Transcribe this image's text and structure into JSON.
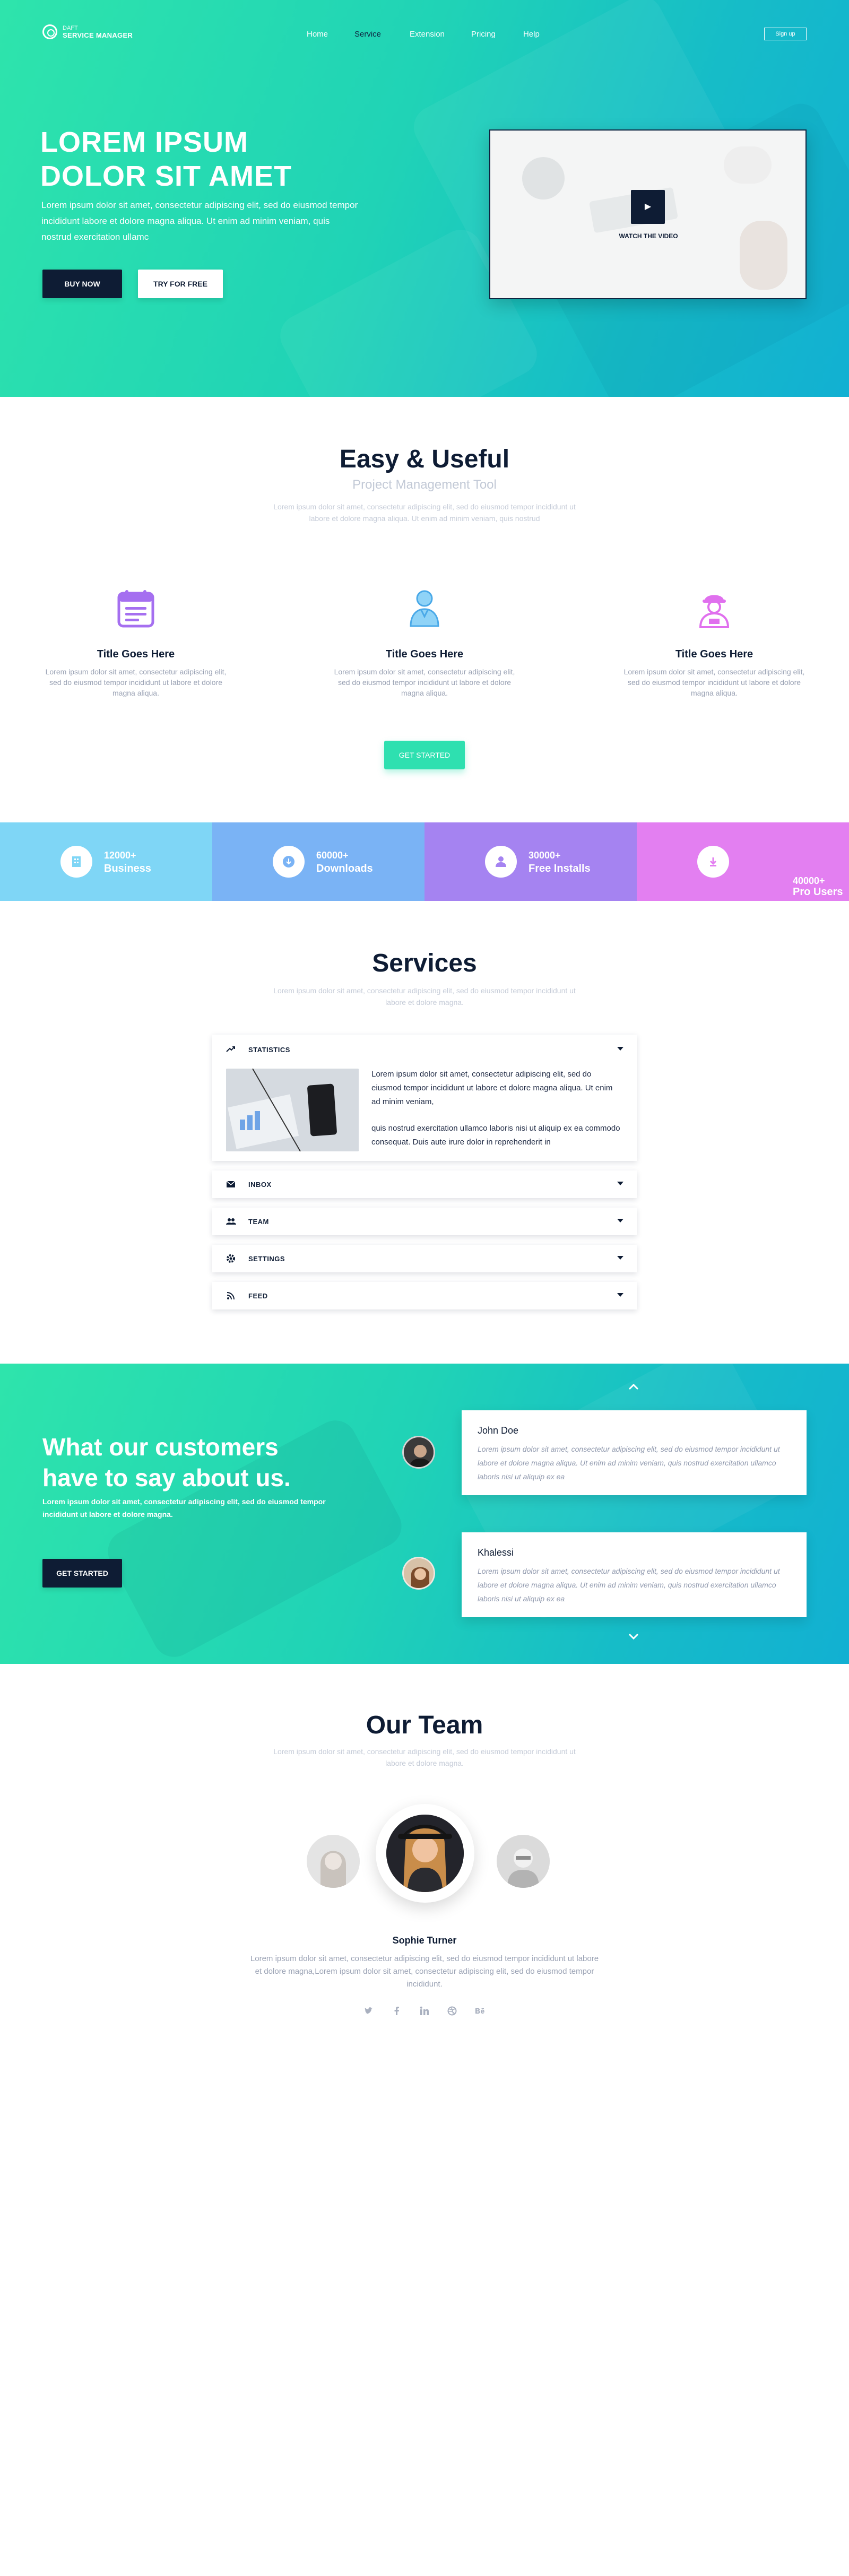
{
  "colors": {
    "primary_teal": "#2ee0b0",
    "dark_navy": "#0e1c34",
    "stat_1": "#7fd6f6",
    "stat_2": "#7ab3f5",
    "stat_3": "#a583f1",
    "stat_4": "#e37ff1"
  },
  "nav": {
    "logo_top": "DAFT",
    "logo_bottom": "SERVICE MANAGER",
    "items": [
      "Home",
      "Service",
      "Extension",
      "Pricing",
      "Help"
    ],
    "active": "Service",
    "signup": "Sign up"
  },
  "hero": {
    "title": "LOREM IPSUM DOLOR SIT AMET",
    "text": "Lorem ipsum dolor sit amet, consectetur adipiscing elit, sed do eiusmod tempor incididunt labore et dolore magna aliqua. Ut enim ad minim veniam, quis nostrud exercitation ullamc",
    "buy_now": "BUY NOW",
    "try_free": "TRY FOR FREE",
    "watch": "WATCH THE VIDEO"
  },
  "easy": {
    "title": "Easy & Useful",
    "subtitle": "Project Management Tool",
    "desc": "Lorem ipsum dolor sit amet, consectetur adipiscing elit, sed do eiusmod tempor incididunt ut labore et dolore magna aliqua. Ut enim ad minim veniam, quis nostrud",
    "features": [
      {
        "icon": "calendar-icon",
        "title": "Title Goes Here",
        "desc": "Lorem ipsum dolor sit amet, consectetur adipiscing elit, sed do eiusmod tempor incididunt ut labore et dolore magna aliqua."
      },
      {
        "icon": "user-icon",
        "title": "Title Goes Here",
        "desc": "Lorem ipsum dolor sit amet, consectetur adipiscing elit, sed do eiusmod tempor incididunt ut labore et dolore magna aliqua."
      },
      {
        "icon": "worker-icon",
        "title": "Title Goes Here",
        "desc": "Lorem ipsum dolor sit amet, consectetur adipiscing elit, sed do eiusmod tempor incididunt ut labore et dolore magna aliqua."
      }
    ],
    "button": "GET STARTED"
  },
  "stats": [
    {
      "icon": "building-icon",
      "number": "12000+",
      "label": "Business"
    },
    {
      "icon": "download-icon",
      "number": "60000+",
      "label": "Downloads"
    },
    {
      "icon": "person-icon",
      "number": "30000+",
      "label": "Free Installs"
    },
    {
      "icon": "download-icon",
      "number": "40000+",
      "label": "Pro Users"
    }
  ],
  "services": {
    "title": "Services",
    "desc": "Lorem ipsum dolor sit amet, consectetur adipiscing elit, sed do eiusmod tempor incididunt ut labore et dolore magna.",
    "items": [
      {
        "icon": "trending-icon",
        "label": "STATISTICS",
        "expanded": true,
        "text1": "Lorem ipsum dolor sit amet, consectetur adipiscing elit, sed do eiusmod tempor incididunt ut labore et dolore magna aliqua. Ut enim ad minim veniam,",
        "text2": "quis nostrud exercitation ullamco laboris nisi ut aliquip ex ea commodo consequat. Duis aute irure dolor in reprehenderit in"
      },
      {
        "icon": "mail-icon",
        "label": "INBOX"
      },
      {
        "icon": "team-icon",
        "label": "TEAM"
      },
      {
        "icon": "gear-icon",
        "label": "SETTINGS"
      },
      {
        "icon": "rss-icon",
        "label": "FEED"
      }
    ]
  },
  "testimonials": {
    "title": "What our customers have to say about us.",
    "desc": "Lorem ipsum dolor sit amet, consectetur adipiscing elit, sed do eiusmod tempor incididunt ut labore et dolore magna.",
    "button": "GET STARTED",
    "items": [
      {
        "name": "John Doe",
        "text": "Lorem ipsum dolor sit amet, consectetur adipiscing elit, sed do eiusmod tempor incididunt ut labore et dolore magna aliqua. Ut enim ad minim veniam, quis nostrud exercitation ullamco laboris nisi ut aliquip ex ea"
      },
      {
        "name": "Khalessi",
        "text": "Lorem ipsum dolor sit amet, consectetur adipiscing elit, sed do eiusmod tempor incididunt ut labore et dolore magna aliqua. Ut enim ad minim veniam, quis nostrud exercitation ullamco laboris nisi ut aliquip ex ea"
      }
    ]
  },
  "team": {
    "title": "Our Team",
    "desc": "Lorem ipsum dolor sit amet, consectetur adipiscing elit, sed do eiusmod tempor incididunt ut labore et dolore magna.",
    "member_name": "Sophie Turner",
    "member_bio": "Lorem ipsum dolor sit amet, consectetur adipiscing elit, sed do eiusmod tempor incididunt ut labore et dolore magna,Lorem ipsum dolor sit amet, consectetur adipiscing elit, sed do eiusmod tempor incididunt.",
    "socials": [
      "twitter-icon",
      "facebook-icon",
      "linkedin-icon",
      "dribbble-icon",
      "behance-icon"
    ]
  }
}
